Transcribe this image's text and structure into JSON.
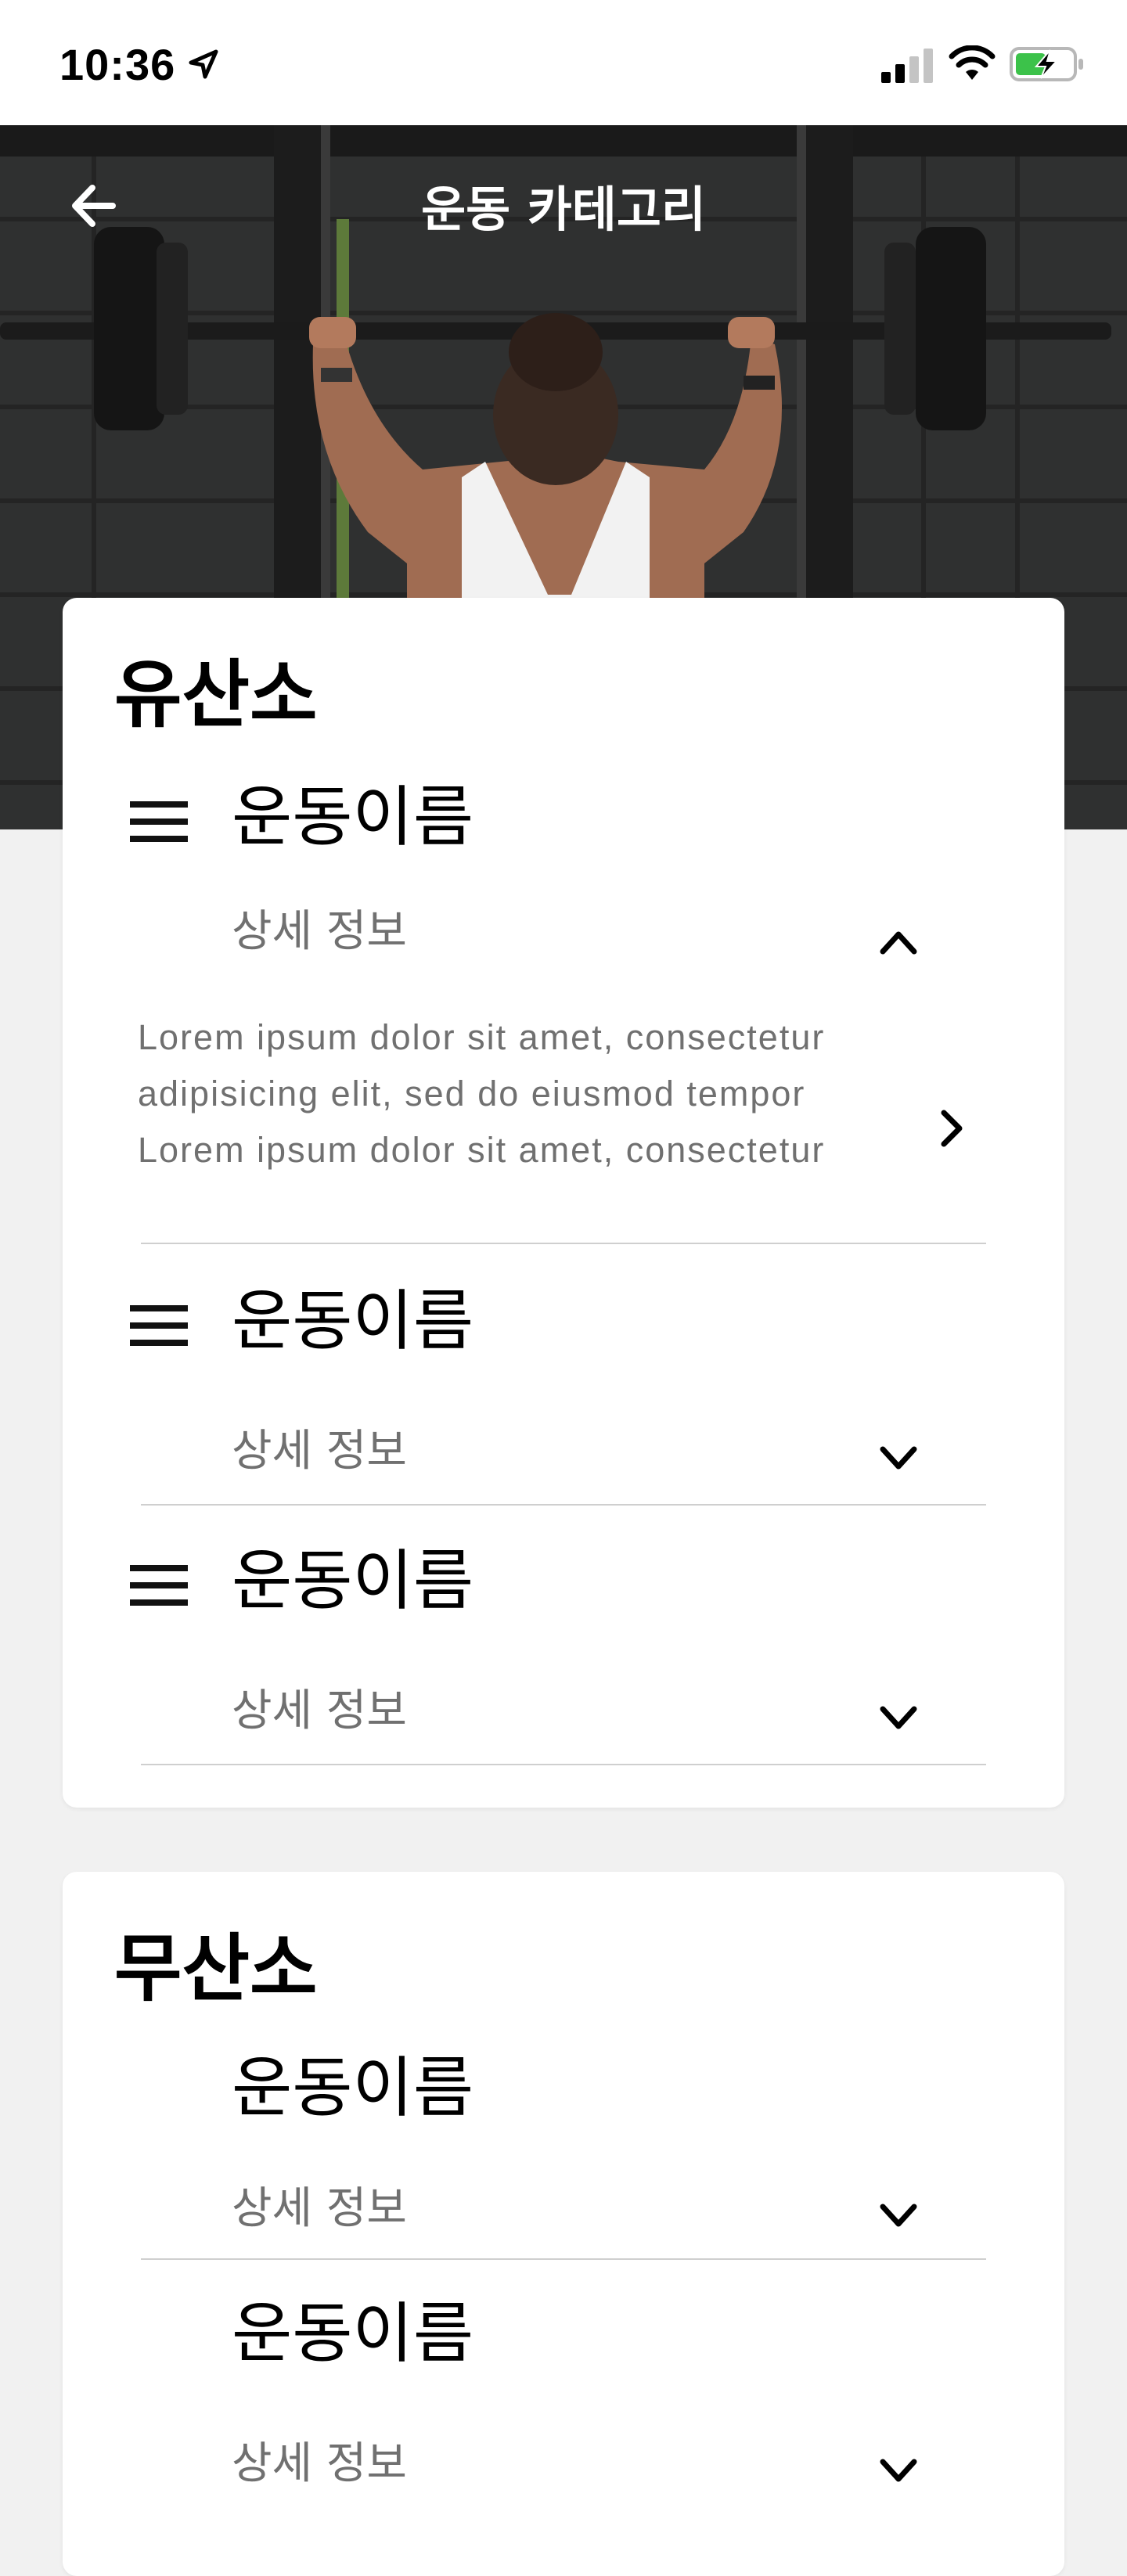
{
  "status": {
    "time": "10:36"
  },
  "header": {
    "title": "운동 카테고리"
  },
  "sections": [
    {
      "title": "유산소",
      "exercises": [
        {
          "name": "운동이름",
          "detail_label": "상세 정보",
          "expanded": true,
          "description": [
            "Lorem ipsum dolor sit amet, consectetur",
            "adipisicing elit, sed do eiusmod tempor",
            "Lorem ipsum dolor sit amet, consectetur"
          ]
        },
        {
          "name": "운동이름",
          "detail_label": "상세 정보",
          "expanded": false
        },
        {
          "name": "운동이름",
          "detail_label": "상세 정보",
          "expanded": false
        }
      ]
    },
    {
      "title": "무산소",
      "exercises": [
        {
          "name": "운동이름",
          "detail_label": "상세 정보",
          "expanded": false
        },
        {
          "name": "운동이름",
          "detail_label": "상세 정보",
          "expanded": false
        }
      ]
    }
  ],
  "icons": {
    "back": "arrow-left-icon",
    "menu": "hamburger-icon",
    "collapse": "chevron-up-icon",
    "expand": "chevron-down-icon",
    "open": "chevron-right-icon"
  },
  "colors": {
    "battery": "#3cc24a",
    "detail_text": "#707070"
  }
}
